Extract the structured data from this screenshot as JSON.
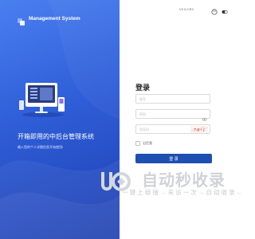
{
  "brand": {
    "name": "Management System"
  },
  "hero": {
    "slogan": "开箱即用的中后台管理系统",
    "subtitle": "输入您的个人详细信息开始使用!"
  },
  "header": {
    "version": "V2.0.0.RC",
    "icons": [
      "palette-icon",
      "dark-mode-icon"
    ]
  },
  "login": {
    "title": "登录",
    "username_placeholder": "账号",
    "password_placeholder": "密码",
    "captcha_placeholder": "验证码",
    "captcha_text": "7·8+1",
    "remember_label": "记住我",
    "submit_label": "登 录"
  },
  "watermark": {
    "title": "自动秒收录",
    "subtitle": "一 键 上 链 接 → 来 访 一 次 → 自 动 收 录 ←"
  },
  "colors": {
    "left_panel": "#2f5ed8",
    "button": "#1f4fb0",
    "brand_logo": "#5b8cff"
  }
}
